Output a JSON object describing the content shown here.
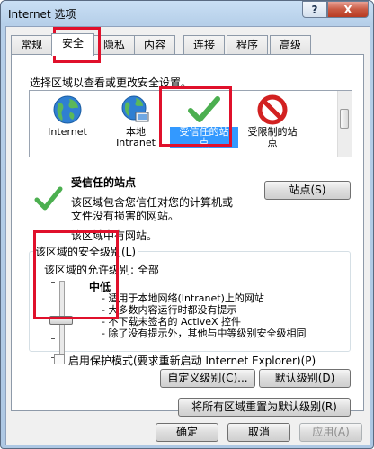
{
  "window": {
    "title": "Internet 选项",
    "help_label": "?",
    "close_label": "X"
  },
  "tabs": [
    {
      "label": "常规"
    },
    {
      "label": "安全"
    },
    {
      "label": "隐私"
    },
    {
      "label": "内容"
    },
    {
      "label": "连接"
    },
    {
      "label": "程序"
    },
    {
      "label": "高级"
    }
  ],
  "active_tab": "安全",
  "zones_prompt": "选择区域以查看或更改安全设置。",
  "zones": [
    {
      "line1": "Internet",
      "line2": "",
      "icon": "globe-icon"
    },
    {
      "line1": "本地",
      "line2": "Intranet",
      "icon": "intranet-globe-icon"
    },
    {
      "line1": "受信任的站",
      "line2": "点",
      "icon": "checkmark-icon",
      "selected": true
    },
    {
      "line1": "受限制的站",
      "line2": "点",
      "icon": "restricted-icon"
    }
  ],
  "zone_info": {
    "title": "受信任的站点",
    "desc_line1": "该区域包含您信任对您的计算机或",
    "desc_line2": "文件没有损害的网站。",
    "sites_button": "站点(S)",
    "has_sites": "该区域中有网站。"
  },
  "security_level": {
    "group_label": "该区域的安全级别(L)",
    "allowed_levels": "该区域的允许级别: 全部",
    "level_name": "中低",
    "slider_value": 0.5,
    "bullets": [
      "- 适用于本地网络(Intranet)上的网站",
      "- 大多数内容运行时都没有提示",
      "- 不下载未签名的 ActiveX 控件",
      "- 除了没有提示外，其他与中等级别安全级相同"
    ]
  },
  "protected_mode": {
    "label": "启用保护模式(要求重新启动 Internet Explorer)(P)",
    "checked": false
  },
  "buttons": {
    "custom_level": "自定义级别(C)...",
    "default_level": "默认级别(D)",
    "reset_all": "将所有区域重置为默认级别(R)",
    "ok": "确定",
    "cancel": "取消",
    "apply": "应用(A)"
  },
  "colors": {
    "selection": "#3399ff",
    "highlight_box": "#e0102b",
    "check_green": "#4caf50"
  }
}
